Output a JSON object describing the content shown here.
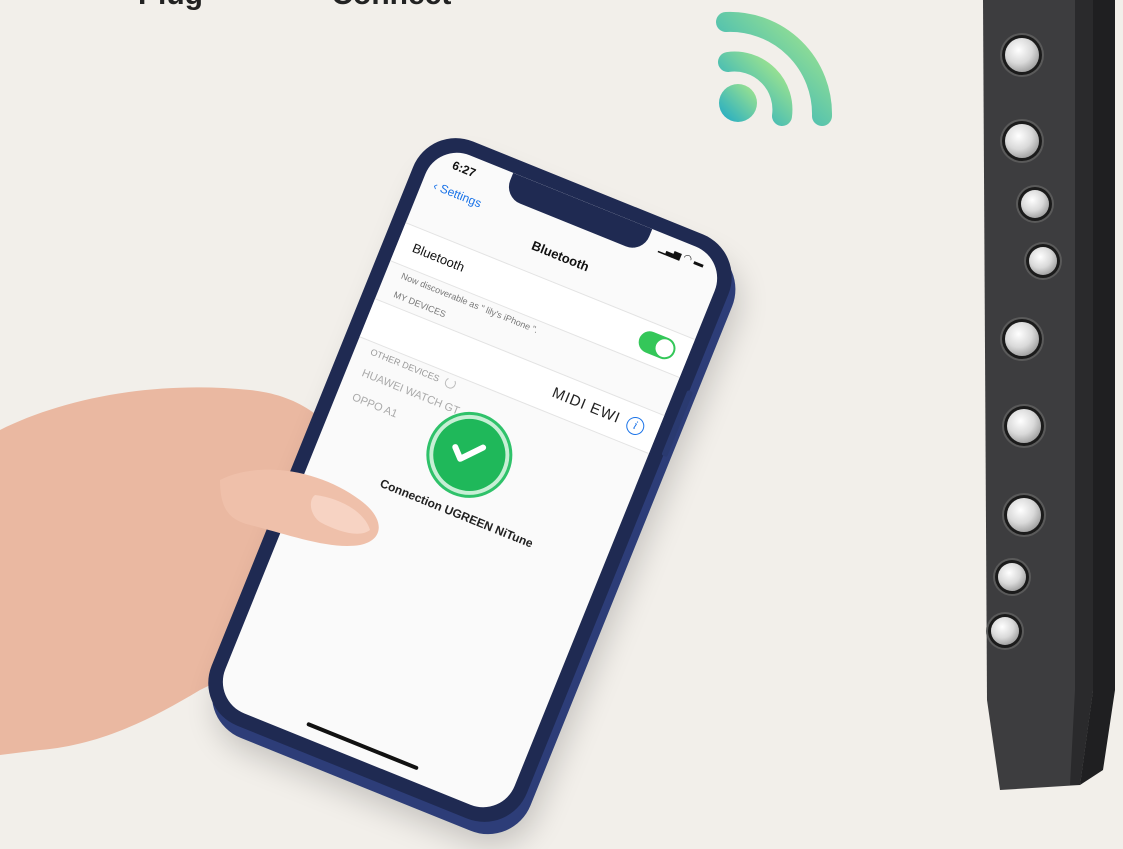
{
  "header": {
    "title_part1": "Plug",
    "title_part2": "Connect"
  },
  "phone": {
    "status_time": "6:27",
    "status_icons": "▁▃▅ ◠ ▬",
    "nav_back_label": "‹ Settings",
    "nav_title": "Bluetooth",
    "bluetooth_label": "Bluetooth",
    "bluetooth_on": true,
    "discoverable_text": "Now discoverable as \" lily's iPhone \".",
    "my_devices_header": "MY DEVICES",
    "device_name": "MIDI EWI",
    "info_icon": "i",
    "other_devices_header": "OTHER DEVICES",
    "other_devices": [
      "HUAWEI WATCH GT",
      "OPPO A1"
    ],
    "connection_text": "Connection UGREEN NiTune"
  },
  "colors": {
    "background": "#f2efea",
    "phone_frame": "#1f2a52",
    "toggle_on": "#34c759",
    "check_green": "#1fb85a",
    "signal_gradient_start": "#1aa8c8",
    "signal_gradient_end": "#a8e88a"
  },
  "icons": {
    "signal": "wireless-signal-icon",
    "check": "checkmark-icon",
    "info": "info-icon"
  }
}
